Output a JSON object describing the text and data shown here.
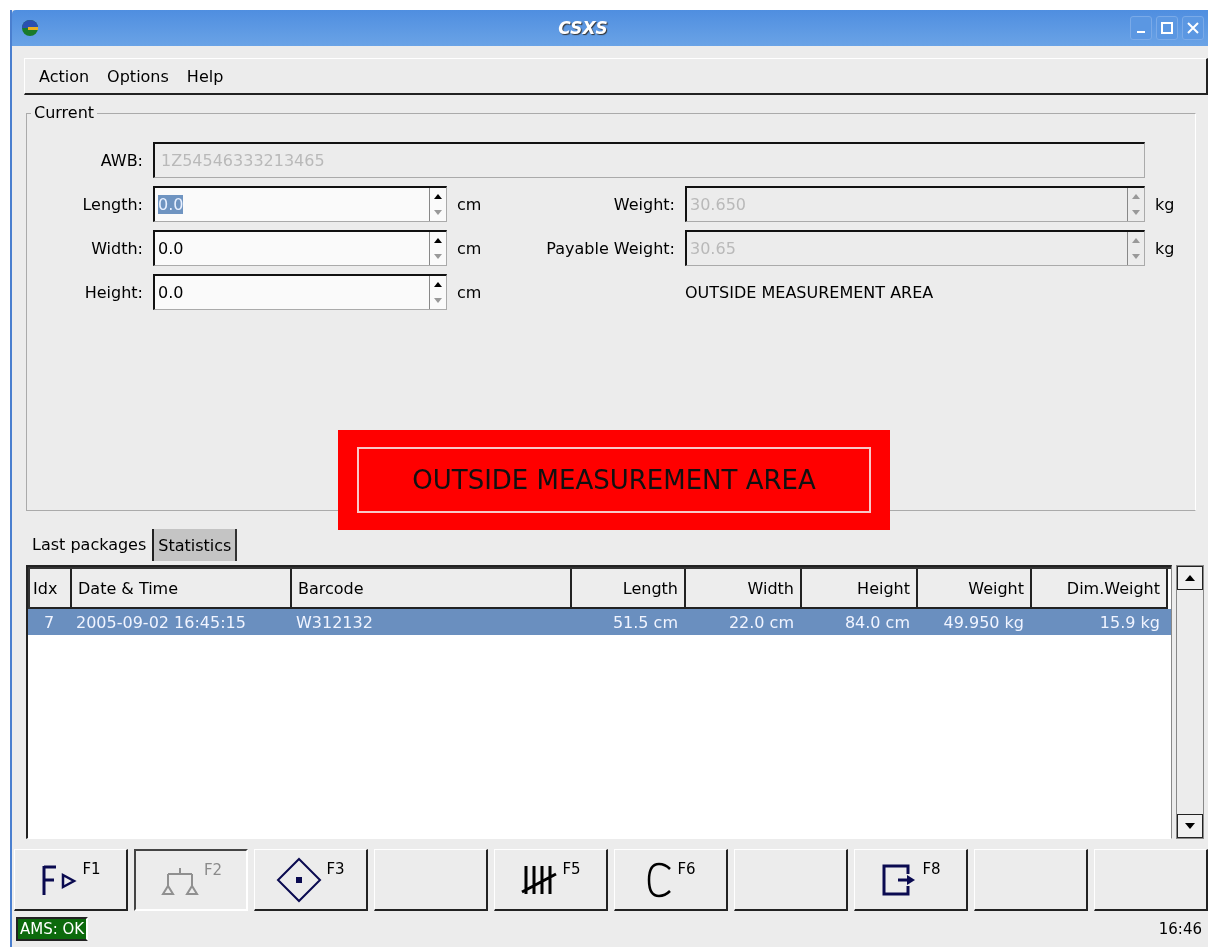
{
  "window": {
    "title": "CSXS"
  },
  "menu": [
    {
      "label": "Action"
    },
    {
      "label": "Options"
    },
    {
      "label": "Help"
    }
  ],
  "current": {
    "title": "Current",
    "awb": {
      "label": "AWB:",
      "value": "1Z54546333213465",
      "disabled": true
    },
    "left_fields": [
      {
        "label": "Length:",
        "value": "0.0",
        "unit": "cm",
        "disabled": false,
        "highlighted": true
      },
      {
        "label": "Width:",
        "value": "0.0",
        "unit": "cm",
        "disabled": false,
        "highlighted": false
      },
      {
        "label": "Height:",
        "value": "0.0",
        "unit": "cm",
        "disabled": false,
        "highlighted": false
      }
    ],
    "right_fields": [
      {
        "label": "Weight:",
        "value": "30.650",
        "unit": "kg",
        "disabled": true,
        "highlighted": false
      },
      {
        "label": "Payable Weight:",
        "value": "30.65",
        "unit": "kg",
        "disabled": true,
        "highlighted": false
      }
    ],
    "status_text": "OUTSIDE MEASUREMENT AREA"
  },
  "alert": {
    "text": "OUTSIDE MEASUREMENT AREA"
  },
  "tabs": [
    {
      "label": "Last packages",
      "selected": true
    },
    {
      "label": "Statistics",
      "selected": false
    }
  ],
  "table": {
    "columns": [
      "Idx",
      "Date & Time",
      "Barcode",
      "Length",
      "Width",
      "Height",
      "Weight",
      "Dim.Weight"
    ],
    "rows": [
      {
        "cells": [
          "7",
          "2005-09-02 16:45:15",
          "W312132",
          "51.5 cm",
          "22.0 cm",
          "84.0 cm",
          "49.950 kg",
          "15.9 kg"
        ],
        "selected": true
      }
    ]
  },
  "function_keys": [
    {
      "kind": "run",
      "key": "F1",
      "disabled": false
    },
    {
      "kind": "scale",
      "key": "F2",
      "disabled": true
    },
    {
      "kind": "target",
      "key": "F3",
      "disabled": false
    },
    {
      "kind": "blank"
    },
    {
      "kind": "tally",
      "key": "F5",
      "disabled": false
    },
    {
      "kind": "clear",
      "key": "F6",
      "disabled": false
    },
    {
      "kind": "blank"
    },
    {
      "kind": "exit",
      "key": "F8",
      "disabled": false
    },
    {
      "kind": "blank"
    },
    {
      "kind": "blank"
    }
  ],
  "status_bar": {
    "ams": "AMS: OK",
    "time": "16:46"
  }
}
